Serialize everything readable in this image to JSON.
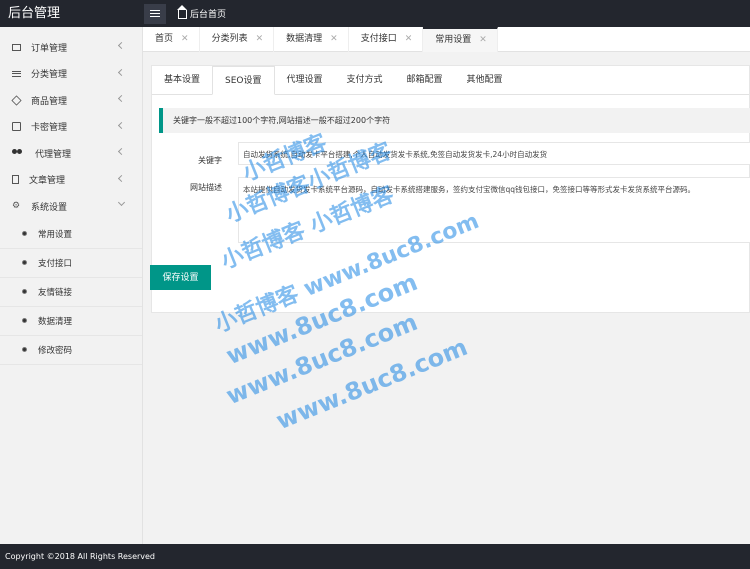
{
  "app": {
    "title": "后台管理"
  },
  "header": {
    "home_label": "后台首页"
  },
  "sidebar": {
    "items": [
      {
        "label": "订单管理",
        "icon": "message-icon"
      },
      {
        "label": "分类管理",
        "icon": "list-icon"
      },
      {
        "label": "商品管理",
        "icon": "cube-icon"
      },
      {
        "label": "卡密管理",
        "icon": "card-icon"
      },
      {
        "label": "代理管理",
        "icon": "users-icon"
      },
      {
        "label": "文章管理",
        "icon": "file-icon"
      },
      {
        "label": "系统设置",
        "icon": "gear-icon"
      }
    ],
    "sub_items": [
      "常用设置",
      "支付接口",
      "友情链接",
      "数据清理",
      "修改密码"
    ]
  },
  "tabs": [
    {
      "label": "首页",
      "close": "✕"
    },
    {
      "label": "分类列表",
      "close": "✕"
    },
    {
      "label": "数据清理",
      "close": "✕"
    },
    {
      "label": "支付接口",
      "close": "✕"
    },
    {
      "label": "常用设置",
      "close": "✕"
    }
  ],
  "settings": {
    "subtabs": [
      "基本设置",
      "SEO设置",
      "代理设置",
      "支付方式",
      "邮箱配置",
      "其他配置"
    ],
    "tip": "关键字一般不超过100个字符,网站描述一般不超过200个字符",
    "keywords_label": "关键字",
    "keywords_value": "自动发货系统,自动发卡平台搭建,个人自动发货发卡系统,免签自动发货发卡,24小时自动发货",
    "description_label": "网站描述",
    "description_value": "本站提供自动发货发卡系统平台源码，自动发卡系统搭建服务，签约支付宝微信qq钱包接口，免签接口等等形式发卡发货系统平台源码。",
    "save_label": "保存设置"
  },
  "watermark": {
    "lines": [
      "小哲博客",
      "小哲博客小哲博客",
      "小哲博客 小哲博客",
      "小哲博客 www.8uc8.com",
      "www.8uc8.com",
      "www.8uc8.com",
      "www.8uc8.com"
    ]
  },
  "footer": {
    "text": "Copyright ©2018 All Rights Reserved"
  },
  "colors": {
    "dark": "#23262e",
    "accent": "#009688"
  }
}
